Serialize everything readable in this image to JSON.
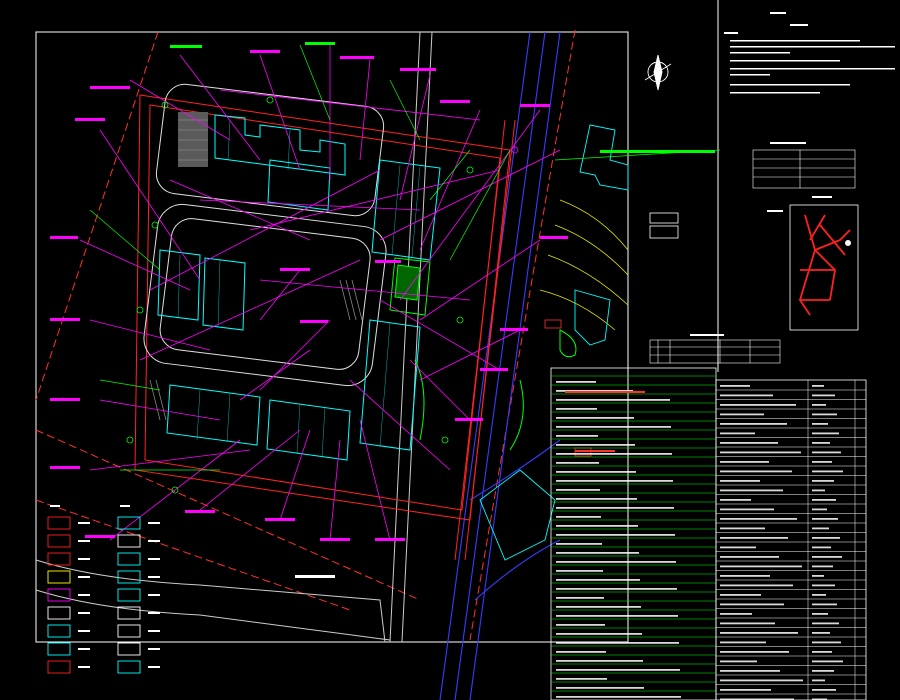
{
  "colors": {
    "background": "#000000",
    "frame": "#ffffff",
    "leader": "#ff00ff",
    "building": "#00ffff",
    "road_red": "#ff2020",
    "green": "#00ff00",
    "blue": "#3030ff",
    "yellow": "#ffff00",
    "note_text": "#ffffff"
  },
  "north_arrow": {
    "icon": "north-arrow-icon"
  },
  "location_map": {
    "icon": "location-map-icon"
  },
  "legend": {
    "icon": "legend-swatches-icon"
  },
  "tables": {
    "icon": "technical-table-icon"
  }
}
